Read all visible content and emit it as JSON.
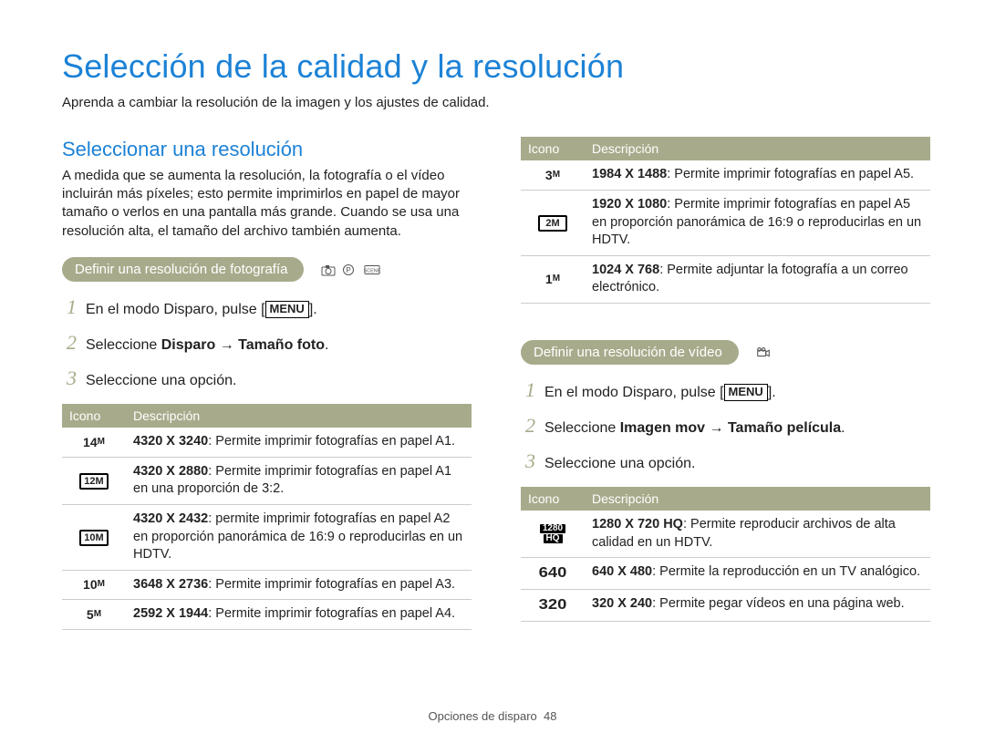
{
  "title": "Selección de la calidad y la resolución",
  "lead": "Aprenda a cambiar la resolución de la imagen y los ajustes de calidad.",
  "left": {
    "section_h": "Seleccionar una resolución",
    "section_p": "A medida que se aumenta la resolución, la fotografía o el vídeo incluirán más píxeles; esto permite imprimirlos en papel de mayor tamaño o verlos en una pantalla más grande. Cuando se usa una resolución alta, el tamaño del archivo también aumenta.",
    "pill": "Definir una resolución de fotografía",
    "step1_pre": "En el modo Disparo, pulse [",
    "step1_key": "MENU",
    "step1_post": "].",
    "step2_pre": "Seleccione ",
    "step2_bold": "Disparo → Tamaño foto",
    "step2_post": ".",
    "step3": "Seleccione una opción.",
    "th_icon": "Icono",
    "th_desc": "Descripción",
    "rows": [
      {
        "icon_kind": "mp",
        "big": "14",
        "small": "M",
        "res": "4320 X 3240",
        "desc": ": Permite imprimir fotografías en papel A1."
      },
      {
        "icon_kind": "box",
        "box": "12M",
        "res": "4320 X 2880",
        "desc": ": Permite imprimir fotografías en papel A1 en una proporción de 3:2."
      },
      {
        "icon_kind": "box",
        "box": "10M",
        "res": "4320 X 2432",
        "desc": ": permite imprimir fotografías en papel A2 en proporción panorámica de 16:9 o reproducirlas en un HDTV."
      },
      {
        "icon_kind": "mp",
        "big": "10",
        "small": "M",
        "res": "3648 X 2736",
        "desc": ": Permite imprimir fotografías en papel A3."
      },
      {
        "icon_kind": "mp",
        "big": "5",
        "small": "M",
        "res": "2592 X 1944",
        "desc": ": Permite imprimir fotografías en papel A4."
      }
    ]
  },
  "right_top": {
    "th_icon": "Icono",
    "th_desc": "Descripción",
    "rows": [
      {
        "icon_kind": "mp",
        "big": "3",
        "small": "M",
        "res": "1984 X 1488",
        "desc": ": Permite imprimir fotografías en papel A5."
      },
      {
        "icon_kind": "box",
        "box": "2M",
        "res": "1920 X 1080",
        "desc": ": Permite imprimir fotografías en papel A5 en proporción panorámica de 16:9 o reproducirlas en un HDTV."
      },
      {
        "icon_kind": "mp",
        "big": "1",
        "small": "M",
        "res": "1024 X 768",
        "desc": ": Permite adjuntar la fotografía a un correo electrónico."
      }
    ]
  },
  "right_bottom": {
    "pill": "Definir una resolución de vídeo",
    "step1_pre": "En el modo Disparo, pulse [",
    "step1_key": "MENU",
    "step1_post": "].",
    "step2_pre": "Seleccione ",
    "step2_bold": "Imagen mov → Tamaño película",
    "step2_post": ".",
    "step3": "Seleccione una opción.",
    "th_icon": "Icono",
    "th_desc": "Descripción",
    "rows": [
      {
        "icon_kind": "stack",
        "top": "1280",
        "bot": "HQ",
        "res": "1280 X 720 HQ",
        "desc": ": Permite reproducir archivos de alta calidad en un HDTV."
      },
      {
        "icon_kind": "vid",
        "label": "640",
        "res": "640 X 480",
        "desc": ": Permite la reproducción en un TV analógico."
      },
      {
        "icon_kind": "vid",
        "label": "320",
        "res": "320 X 240",
        "desc": ": Permite pegar vídeos en una página web."
      }
    ]
  },
  "footer_section": "Opciones de disparo",
  "footer_page": "48",
  "steps_nums": {
    "n1": "1",
    "n2": "2",
    "n3": "3"
  }
}
